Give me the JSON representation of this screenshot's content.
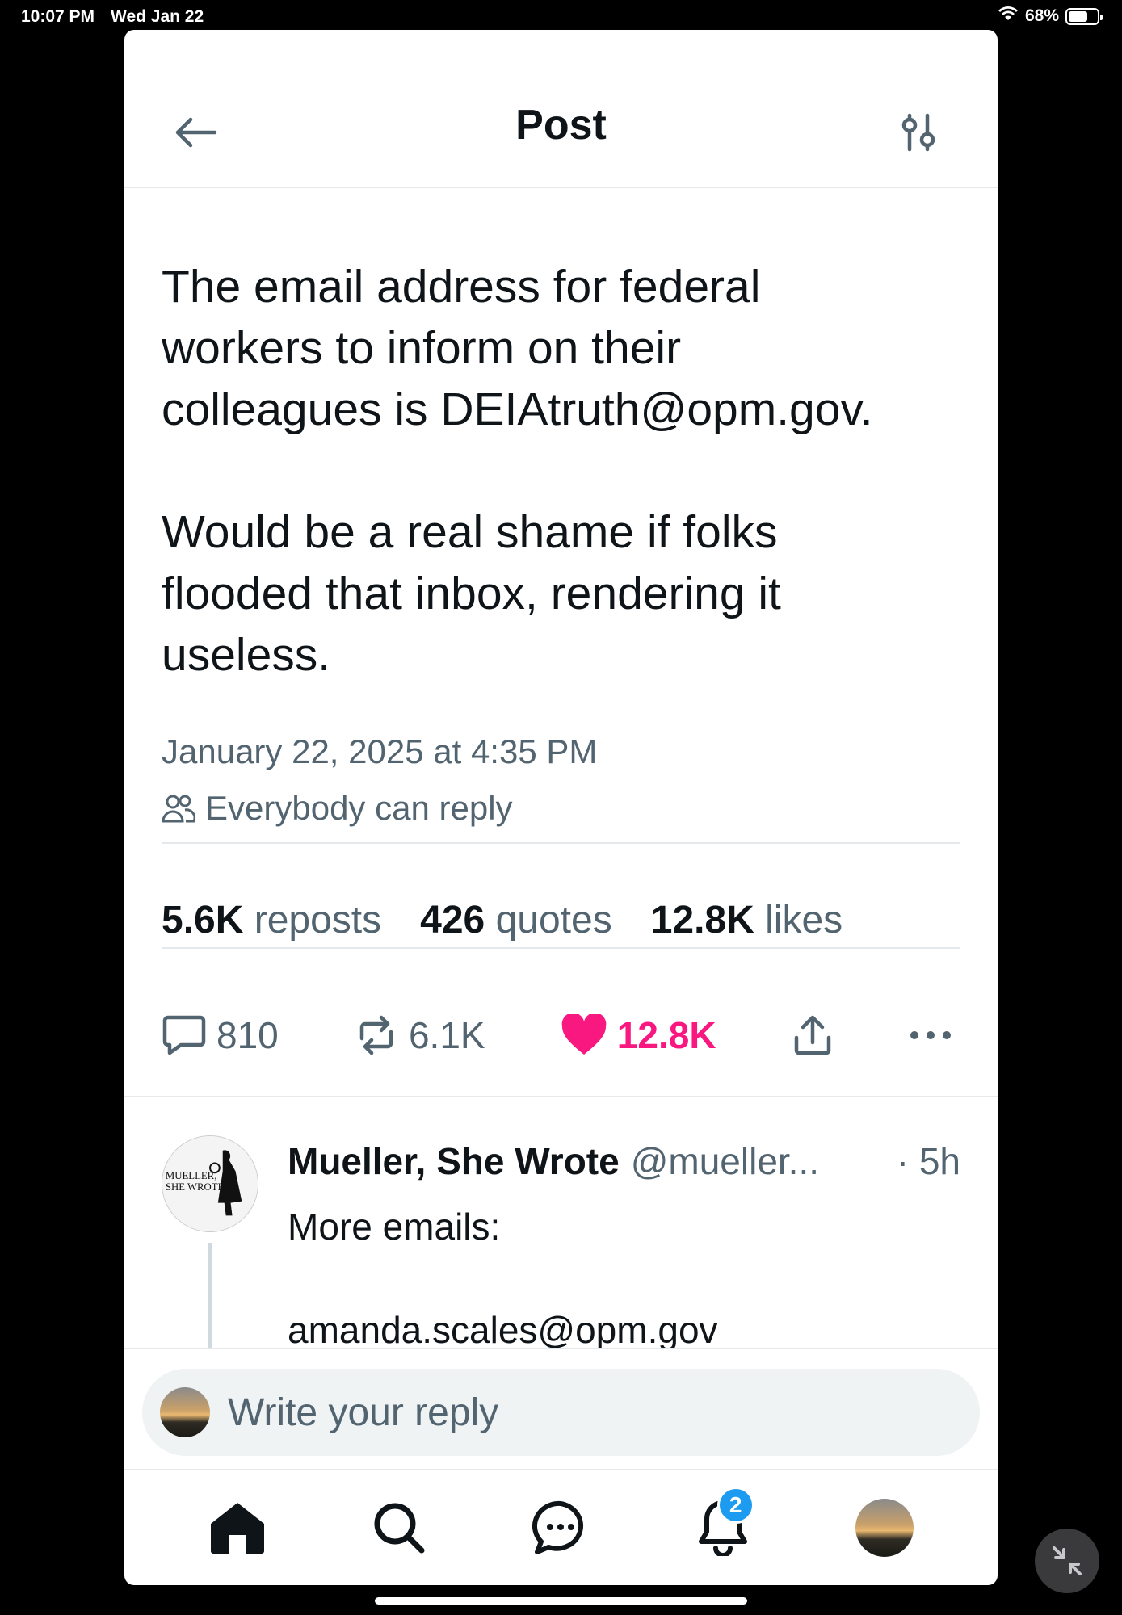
{
  "status_bar": {
    "time": "10:07 PM",
    "date": "Wed Jan 22",
    "battery": "68%",
    "battery_level": 0.68
  },
  "header": {
    "title": "Post"
  },
  "post": {
    "text": "The email address for federal\nworkers to inform on their\ncolleagues is DEIAtruth@opm.gov.\n\nWould be a real shame if folks\nflooded that inbox, rendering it\nuseless.",
    "timestamp": "January 22, 2025 at 4:35 PM",
    "reply_permission": "Everybody can reply"
  },
  "stats": {
    "reposts_count": "5.6K",
    "reposts_label": "reposts",
    "quotes_count": "426",
    "quotes_label": "quotes",
    "likes_count": "12.8K",
    "likes_label": "likes"
  },
  "actions": {
    "replies": "810",
    "reposts": "6.1K",
    "likes": "12.8K",
    "like_color": "#f91880"
  },
  "reply": {
    "name": "Mueller, She Wrote",
    "handle": "@mueller...",
    "age": "· 5h",
    "text": "More emails:\n\namanda.scales@opm.gov",
    "avatar_text_line1": "MUELLER,",
    "avatar_text_line2": "SHE WROTE"
  },
  "composer": {
    "placeholder": "Write your reply"
  },
  "tabbar": {
    "notifications_badge": "2",
    "accent": "#1d9bf0"
  }
}
